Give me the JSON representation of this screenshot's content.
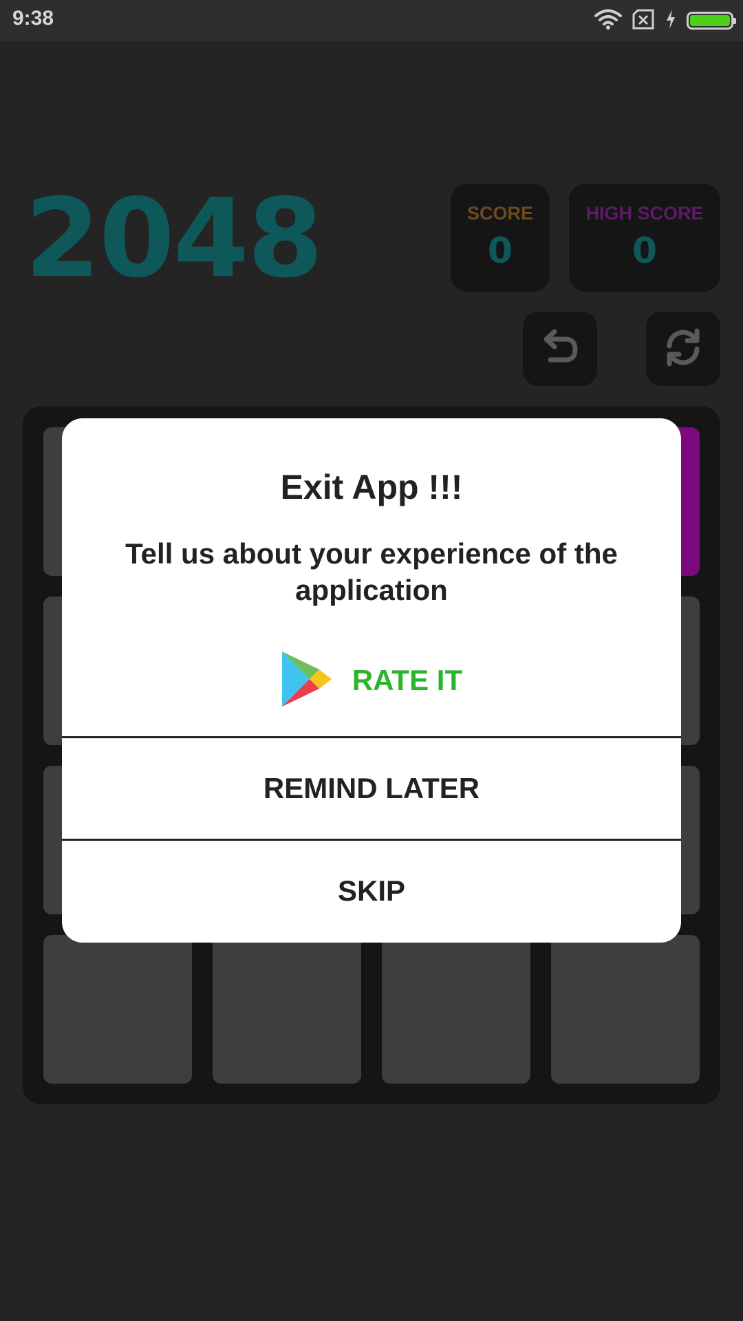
{
  "status_bar": {
    "time": "9:38",
    "icons": [
      "wifi-icon",
      "no-sim-icon",
      "charging-icon",
      "battery-icon"
    ],
    "battery_level": 1.0
  },
  "game": {
    "title": "2048",
    "score": {
      "label": "SCORE",
      "value": "0"
    },
    "high_score": {
      "label": "HIGH SCORE",
      "value": "0"
    },
    "controls": [
      "undo-icon",
      "restart-icon"
    ],
    "colors": {
      "title": "#0f585a",
      "score_label": "#6e4a1f",
      "high_score_label": "#5e1a66",
      "highlight_tile": "#7a0a7e"
    }
  },
  "dialog": {
    "title": "Exit App !!!",
    "message": "Tell us about your experience of the application",
    "rate": {
      "icon": "play-store-icon",
      "label": "RATE IT",
      "color": "#2bb52b"
    },
    "remind_label": "REMIND LATER",
    "skip_label": "SKIP"
  }
}
